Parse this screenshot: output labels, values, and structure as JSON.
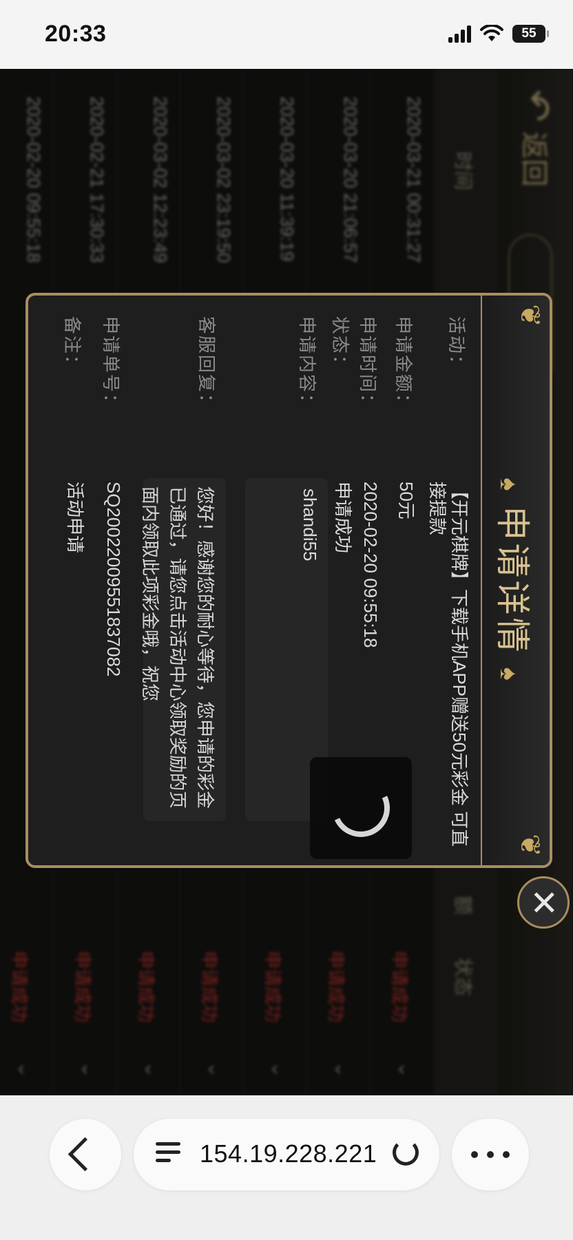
{
  "status_bar": {
    "time": "20:33",
    "battery": "55"
  },
  "background": {
    "back_label": "返回",
    "headers": {
      "time": "时间",
      "amount": "额",
      "status": "状态"
    },
    "rows": [
      {
        "time": "2020-03-21 00:31:27",
        "status": "申请成功"
      },
      {
        "time": "2020-03-20 21:06:57",
        "status": "申请成功"
      },
      {
        "time": "2020-03-20 11:39:19",
        "status": "申请成功"
      },
      {
        "time": "2020-03-02 23:19:50",
        "status": "申请成功"
      },
      {
        "time": "2020-03-02 12:23:49",
        "status": "申请成功"
      },
      {
        "time": "2020-02-21 17:30:33",
        "status": "申请成功"
      },
      {
        "time": "2020-02-20 09:55:18",
        "status": "申请成功"
      }
    ]
  },
  "modal": {
    "title": "申请详情",
    "fields": {
      "activity": {
        "label": "活动：",
        "value": "【开元棋牌】下载手机APP赠送50元彩金 可直接提款"
      },
      "amount": {
        "label": "申请金额：",
        "value": "50元"
      },
      "time": {
        "label": "申请时间：",
        "value": "2020-02-20 09:55:18"
      },
      "status": {
        "label": "状态：",
        "value": "申请成功"
      },
      "content": {
        "label": "申请内容：",
        "value": "shandi55"
      },
      "reply": {
        "label": "客服回复：",
        "value": "您好！感谢您的耐心等待，您申请的彩金已通过，请您点击活动中心领取奖励的页面内领取此项彩金哦，祝您"
      },
      "order": {
        "label": "申请单号：",
        "value": "SQ2002200955183708​2"
      },
      "remark": {
        "label": "备注：",
        "value": "活动申请"
      }
    }
  },
  "browser": {
    "url": "154.19.228.221"
  },
  "icons": [
    "signal-icon",
    "wifi-icon",
    "battery-icon",
    "spade-icon",
    "close-icon",
    "back-icon",
    "tabs-icon",
    "reload-icon",
    "more-icon",
    "spinner-icon"
  ]
}
